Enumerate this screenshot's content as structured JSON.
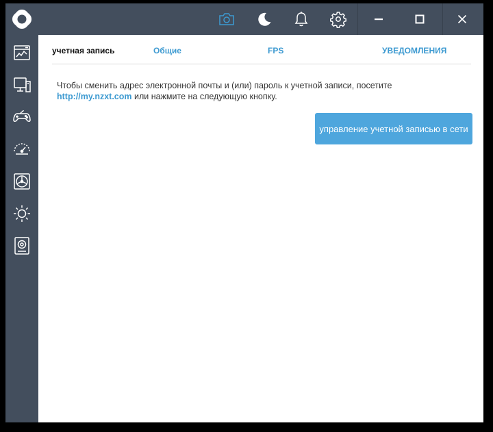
{
  "sidebar": {
    "items": [
      {
        "icon": "dashboard-icon"
      },
      {
        "icon": "pc-monitor-icon"
      },
      {
        "icon": "gamepad-icon"
      },
      {
        "icon": "gauge-icon"
      },
      {
        "icon": "fan-icon"
      },
      {
        "icon": "lighting-sun-icon"
      },
      {
        "icon": "audio-speaker-icon"
      }
    ]
  },
  "topbar": {
    "icons": [
      "camera-icon",
      "moon-icon",
      "bell-icon",
      "gear-icon"
    ],
    "active_icon": "camera-icon",
    "window_controls": [
      "minimize",
      "maximize",
      "close"
    ]
  },
  "tabs": [
    {
      "label": "учетная запись",
      "active": true
    },
    {
      "label": "Общие",
      "active": false
    },
    {
      "label": "FPS",
      "active": false
    },
    {
      "label": "УВЕДОМЛЕНИЯ",
      "active": false
    }
  ],
  "account": {
    "description_start": "Чтобы сменить адрес электронной почты и (или) пароль к учетной записи, посетите ",
    "link_text": "http://my.nzxt.com",
    "description_end": " или нажмите на следующую кнопку.",
    "manage_button": "управление учетной записью в сети"
  },
  "colors": {
    "sidebar_bg": "#434e5d",
    "accent": "#3d9ad1",
    "button_bg": "#4ea6dd"
  }
}
